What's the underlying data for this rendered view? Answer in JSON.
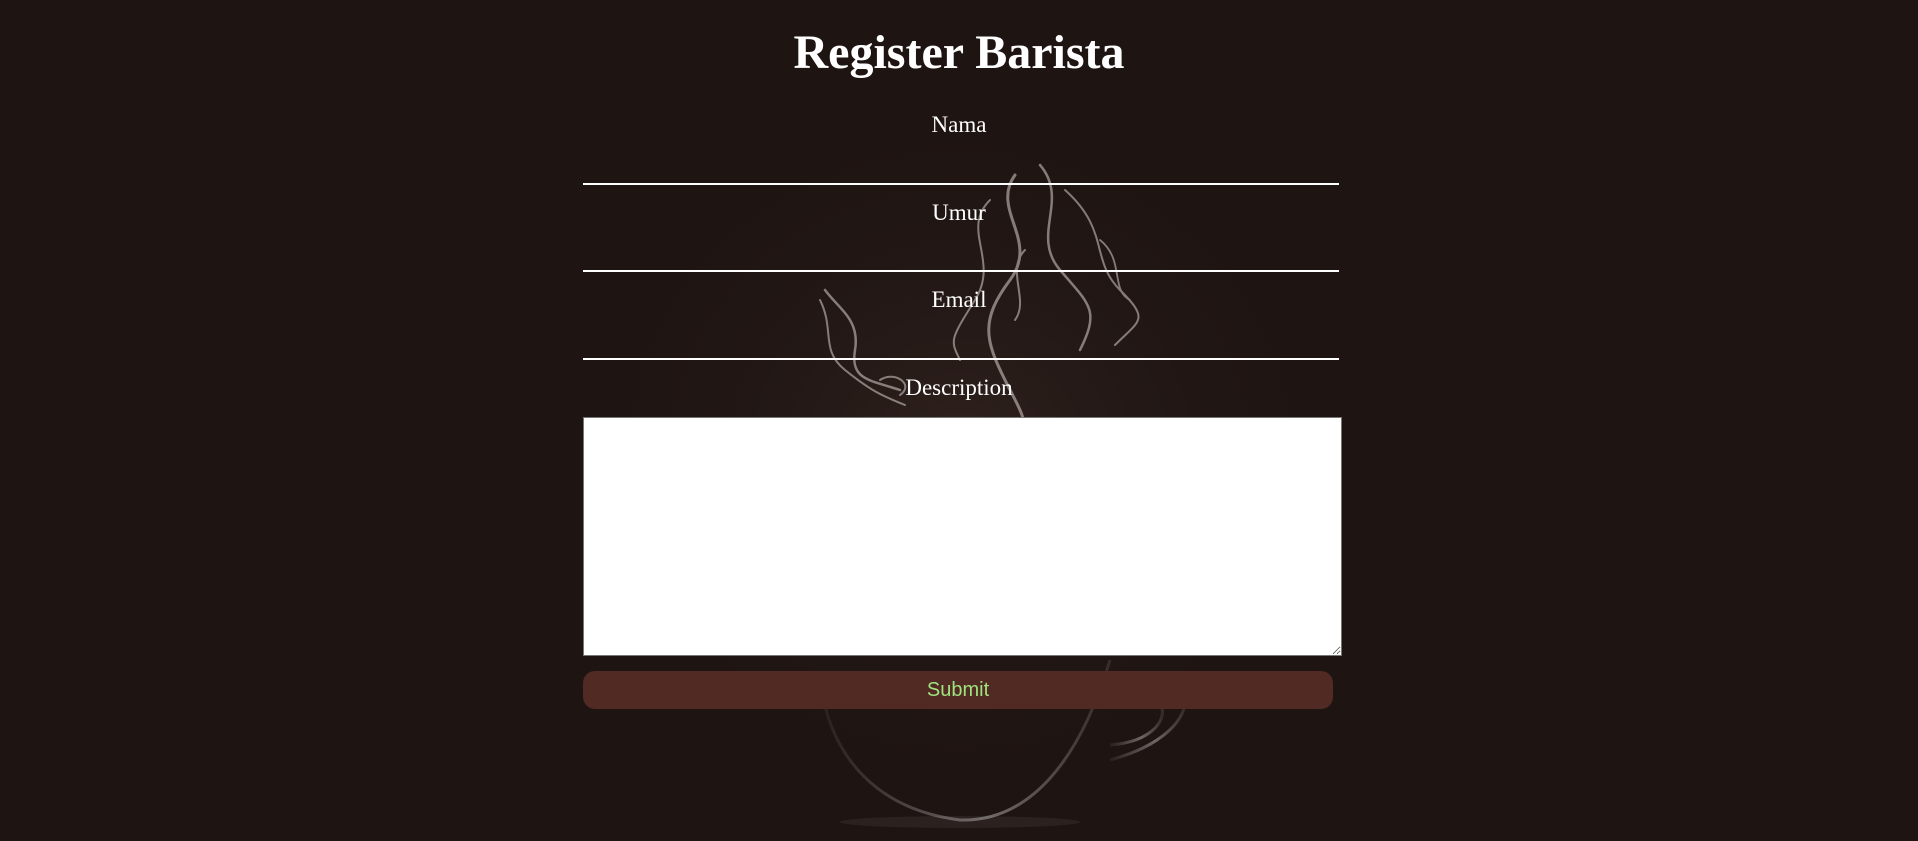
{
  "page": {
    "title": "Register Barista"
  },
  "form": {
    "nama_label": "Nama",
    "nama_value": "",
    "umur_label": "Umur",
    "umur_value": "",
    "email_label": "Email",
    "email_value": "",
    "description_label": "Description",
    "description_value": "",
    "submit_label": "Submit"
  },
  "colors": {
    "background": "#1e1412",
    "text": "#ffffff",
    "button_bg": "#512a24",
    "button_text": "#9fe37f"
  },
  "background_image": "coffee-cup-with-steam"
}
